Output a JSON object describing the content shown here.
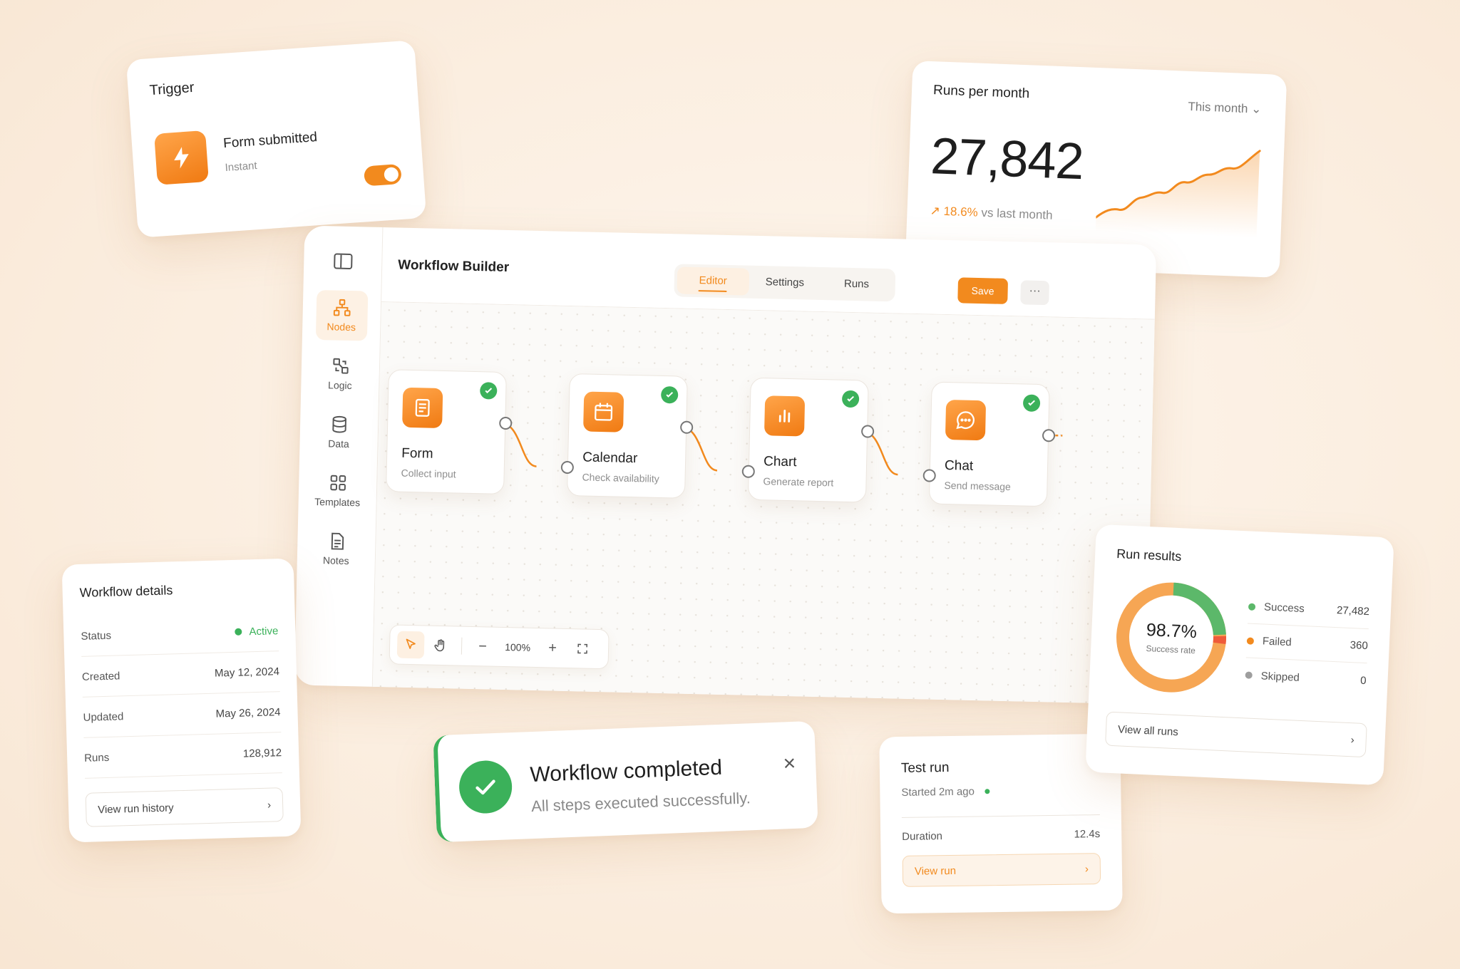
{
  "trigger": {
    "header": "Trigger",
    "title": "Form submitted",
    "subtitle": "Instant",
    "enabled": true
  },
  "runs_per_month": {
    "header": "Runs per month",
    "period": "This month",
    "total": "27,842",
    "delta": "18.6%",
    "delta_suffix": "vs last month"
  },
  "builder": {
    "title": "Workflow Builder",
    "sidebar": [
      {
        "label": "Nodes",
        "icon": "nodes-icon",
        "active": true
      },
      {
        "label": "Logic",
        "icon": "logic-icon",
        "active": false
      },
      {
        "label": "Data",
        "icon": "database-icon",
        "active": false
      },
      {
        "label": "Templates",
        "icon": "templates-icon",
        "active": false
      },
      {
        "label": "Notes",
        "icon": "notes-icon",
        "active": false
      }
    ],
    "tabs": [
      {
        "label": "Editor",
        "active": true
      },
      {
        "label": "Settings",
        "active": false
      },
      {
        "label": "Runs",
        "active": false
      }
    ],
    "save_label": "Save",
    "more_label": "···",
    "nodes": [
      {
        "title": "Form",
        "subtitle": "Collect input",
        "icon": "form-icon",
        "status": "complete"
      },
      {
        "title": "Calendar",
        "subtitle": "Check availability",
        "icon": "calendar-icon",
        "status": "complete"
      },
      {
        "title": "Chart",
        "subtitle": "Generate report",
        "icon": "chart-icon",
        "status": "complete"
      },
      {
        "title": "Chat",
        "subtitle": "Send message",
        "icon": "chat-icon",
        "status": "complete"
      }
    ],
    "toolbar": {
      "zoom_out": "−",
      "zoom": "100%",
      "zoom_in": "+"
    }
  },
  "details": {
    "header": "Workflow details",
    "rows": [
      {
        "label": "Status",
        "value": "Active"
      },
      {
        "label": "Created",
        "value": "May 12, 2024"
      },
      {
        "label": "Updated",
        "value": "May 26, 2024"
      },
      {
        "label": "Runs",
        "value": "128,912"
      }
    ],
    "link": "View run history"
  },
  "toast": {
    "title": "Workflow completed",
    "subtitle": "All steps executed successfully."
  },
  "test_run": {
    "header": "Test run",
    "started": "Started 2m ago",
    "duration_label": "Duration",
    "duration_value": "12.4s",
    "button": "View run"
  },
  "results": {
    "header": "Run results",
    "rate": "98.7%",
    "rate_label": "Success rate",
    "legend": [
      {
        "label": "Success",
        "value": "27,482",
        "color": "#5cb86a"
      },
      {
        "label": "Failed",
        "value": "360",
        "color": "#f28a1e"
      },
      {
        "label": "Skipped",
        "value": "0",
        "color": "#9e9e9e"
      }
    ],
    "link": "View all runs"
  },
  "colors": {
    "accent": "#f28a1e",
    "success": "#3bb15a"
  }
}
